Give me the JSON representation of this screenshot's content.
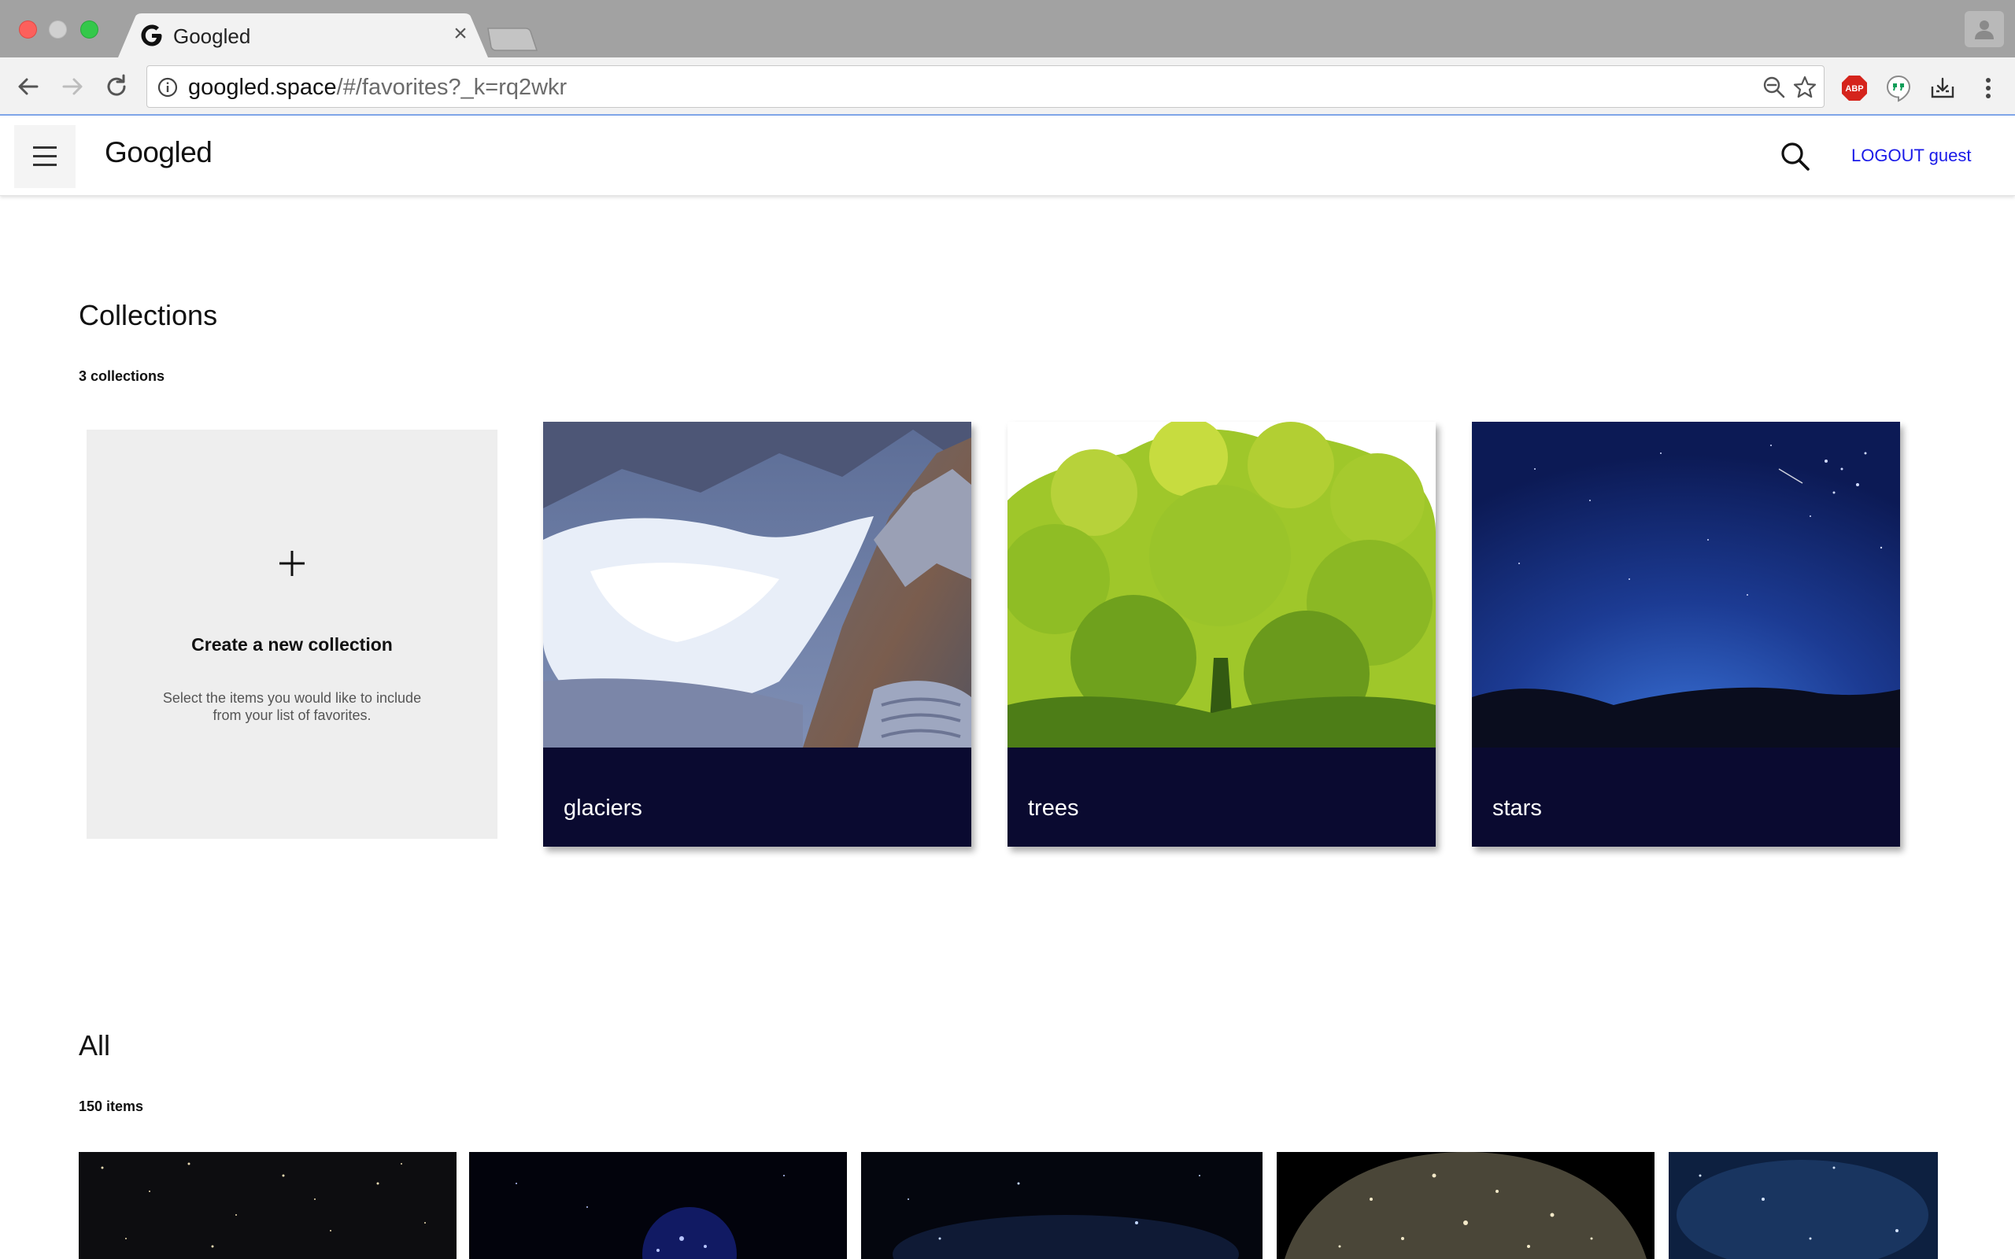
{
  "browser": {
    "tab_title": "Googled",
    "tab_close": "×",
    "url_host": "googled.space",
    "url_path": "/#/favorites?_k=rq2wkr",
    "extensions": {
      "abp_label": "ABP"
    }
  },
  "header": {
    "brand": "Googled",
    "logout_label": "LOGOUT guest"
  },
  "collections": {
    "title": "Collections",
    "count_text": "3 collections",
    "new_collection": {
      "plus": "+",
      "title": "Create a new collection",
      "description": "Select the items you would like to include from your list of favorites."
    },
    "items": [
      {
        "label": "glaciers"
      },
      {
        "label": "trees"
      },
      {
        "label": "stars"
      }
    ]
  },
  "all": {
    "title": "All",
    "count_text": "150 items"
  },
  "colors": {
    "caption_bg": "#0a0a30",
    "link": "#1a1ae8",
    "new_card_bg": "#eeeeee"
  }
}
